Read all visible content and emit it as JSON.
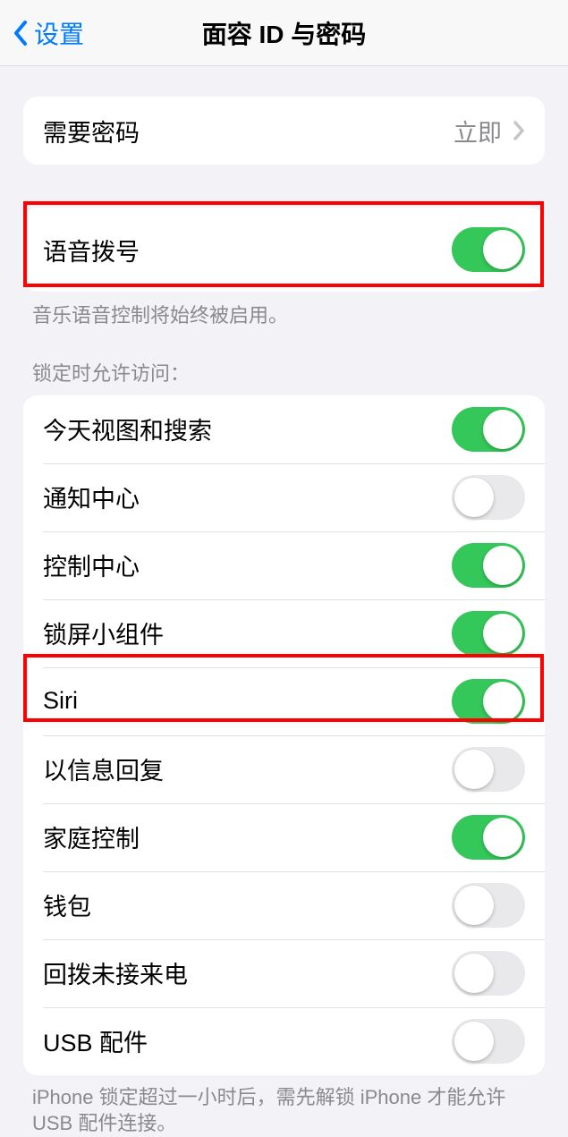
{
  "nav": {
    "back": "设置",
    "title": "面容 ID 与密码"
  },
  "require_passcode": {
    "label": "需要密码",
    "value": "立即"
  },
  "voice_dial": {
    "label": "语音拨号",
    "on": true,
    "footer": "音乐语音控制将始终被启用。"
  },
  "locked_header": "锁定时允许访问：",
  "locked_items": [
    {
      "label": "今天视图和搜索",
      "on": true
    },
    {
      "label": "通知中心",
      "on": false
    },
    {
      "label": "控制中心",
      "on": true
    },
    {
      "label": "锁屏小组件",
      "on": true
    },
    {
      "label": "Siri",
      "on": true
    },
    {
      "label": "以信息回复",
      "on": false
    },
    {
      "label": "家庭控制",
      "on": true
    },
    {
      "label": "钱包",
      "on": false
    },
    {
      "label": "回拨未接来电",
      "on": false
    },
    {
      "label": "USB 配件",
      "on": false
    }
  ],
  "usb_footer": "iPhone 锁定超过一小时后，需先解锁 iPhone 才能允许 USB 配件连接。"
}
